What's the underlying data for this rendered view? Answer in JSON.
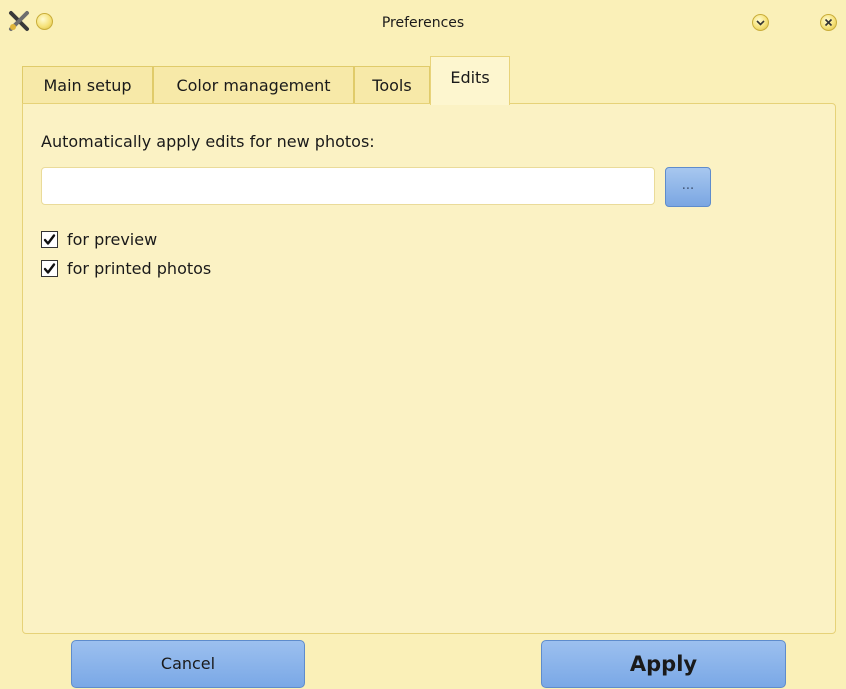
{
  "window": {
    "title": "Preferences",
    "icons": {
      "app": "scissors-x-icon",
      "minimize": "yellow-dot-icon",
      "menu": "chevron-down-icon",
      "close": "close-icon"
    }
  },
  "tabs": [
    {
      "label": "Main setup",
      "active": false
    },
    {
      "label": "Color management",
      "active": false
    },
    {
      "label": "Tools",
      "active": false
    },
    {
      "label": "Edits",
      "active": true
    }
  ],
  "edits": {
    "label": "Automatically apply edits for new photos:",
    "path_value": "",
    "browse_label": "...",
    "options": [
      {
        "label": "for preview",
        "checked": true
      },
      {
        "label": "for printed photos",
        "checked": true
      }
    ]
  },
  "buttons": {
    "cancel": "Cancel",
    "apply": "Apply"
  },
  "colors": {
    "background": "#faf0b8",
    "button": "#8ab3ea",
    "panel": "#fbf2c4"
  }
}
